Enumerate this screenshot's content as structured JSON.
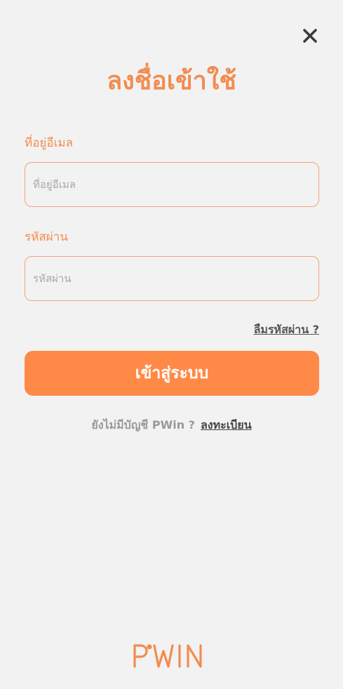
{
  "header": {
    "title": "ลงชื่อเข้าใช้",
    "close_icon": "close-icon"
  },
  "email": {
    "label": "ที่อยู่อีเมล",
    "placeholder": "ที่อยู่อีเมล",
    "value": ""
  },
  "password": {
    "label": "รหัสผ่าน",
    "placeholder": "รหัสผ่าน",
    "value": ""
  },
  "forgot_password": "ลืมรหัสผ่าน ?",
  "login_button": "เข้าสู่ระบบ",
  "signup": {
    "prompt": "ยังไม่มีบัญชี PWin ?",
    "link": "ลงทะเบียน"
  },
  "logo": {
    "text": "PWIN",
    "color": "#f28c50"
  },
  "colors": {
    "accent": "#ff8a47",
    "label": "#f28c50",
    "background": "#f2f2f2"
  }
}
